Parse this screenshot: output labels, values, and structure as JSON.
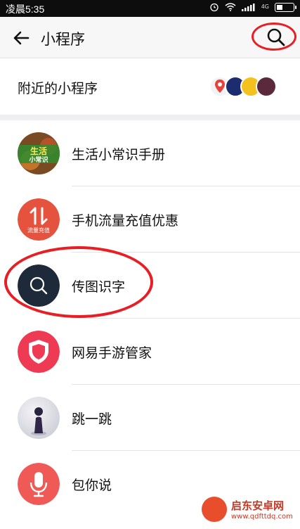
{
  "status_bar": {
    "time": "凌晨5:35",
    "network": "4G"
  },
  "header": {
    "title": "小程序"
  },
  "nearby": {
    "label": "附近的小程序"
  },
  "items": [
    {
      "label": "生活小常识手册",
      "icon": "life-tips-icon",
      "color": "#3a8a2e",
      "art": [
        "生活",
        "小常识"
      ]
    },
    {
      "label": "手机流量充值优惠",
      "icon": "data-topup-icon",
      "color": "#e5533e",
      "art": [
        "流量充值"
      ]
    },
    {
      "label": "传图识字",
      "icon": "search-icon",
      "color": "#1e2a3a"
    },
    {
      "label": "网易手游管家",
      "icon": "shield-icon",
      "color": "#ef3a54"
    },
    {
      "label": "跳一跳",
      "icon": "jump-piece-icon",
      "color": "#d8d8df"
    },
    {
      "label": "包你说",
      "icon": "microphone-icon",
      "color": "#ef5a56"
    }
  ],
  "watermark": {
    "name": "启东安卓网",
    "url": "www.qdfttdq.com"
  },
  "colors": {
    "highlight_ring": "#e81e25",
    "section_gap": "#efeff2"
  }
}
